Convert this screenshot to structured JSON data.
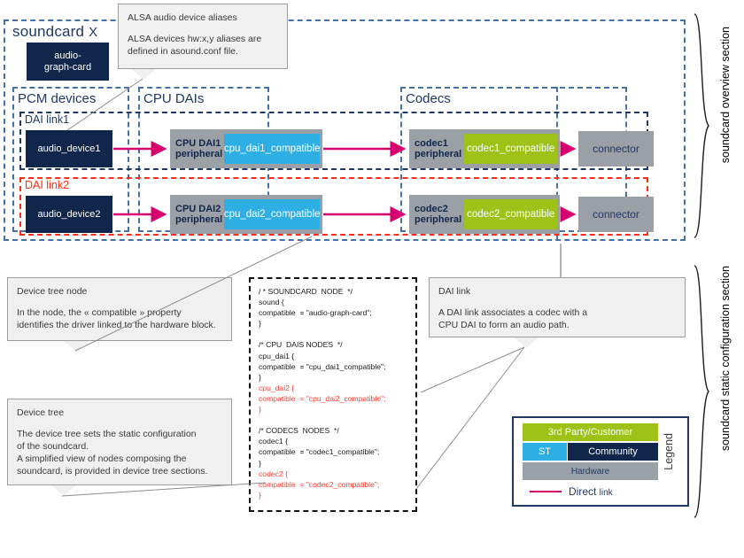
{
  "overview": {
    "soundcard_title": "soundcard",
    "soundcard_suffix": "X",
    "card_driver": "audio-\ngraph-card",
    "groups": {
      "pcm_devices": "PCM devices",
      "cpu_dais": "CPU DAIs",
      "codecs": "Codecs"
    },
    "links": [
      {
        "label": "DAI link1",
        "color": "#1f3864",
        "audio_device": "audio_device1",
        "cpu_dai_label": "CPU DAI1\nperipheral",
        "cpu_dai_compatible": "cpu_dai1_compatible",
        "codec_label": "codec1\nperipheral",
        "codec_compatible": "codec1_compatible",
        "connector": "connector"
      },
      {
        "label": "DAI link2",
        "color": "#ff2d16",
        "audio_device": "audio_device2",
        "cpu_dai_label": "CPU DAI2\nperipheral",
        "cpu_dai_compatible": "cpu_dai2_compatible",
        "codec_label": "codec2\nperipheral",
        "codec_compatible": "codec2_compatible",
        "connector": "connector"
      }
    ]
  },
  "callouts": {
    "alsa": {
      "title": "ALSA audio  device  aliases",
      "text": "ALSA devices  hw:x,y aliases are\ndefined  in asound.conf file."
    },
    "device_tree_node": {
      "title": "Device tree node",
      "text": "In the node, the  « compatible » property\nidentifies the driver  linked to the hardware  block."
    },
    "device_tree": {
      "title": "Device tree",
      "text": "The device  tree  sets the static configuration\nof the soundcard.\nA simplified  view  of nodes composing the\nsoundcard, is provided  in device  tree sections."
    },
    "dai_link": {
      "title": "DAI link",
      "text": "A DAI link  associates a codec with a\nCPU  DAI to form an audio  path."
    }
  },
  "code_block": {
    "lines": [
      {
        "text": "/ * SOUNDCARD  NODE  */",
        "red": false
      },
      {
        "text": "sound {",
        "red": false
      },
      {
        "text": "compatible  = \"audio-graph-card\";",
        "red": false
      },
      {
        "text": "}",
        "red": false
      },
      {
        "text": "",
        "red": false
      },
      {
        "text": "/* CPU  DAIS NODES  */",
        "red": false
      },
      {
        "text": "cpu_dai1 {",
        "red": false
      },
      {
        "text": "compatible  = \"cpu_dai1_compatible\";",
        "red": false
      },
      {
        "text": "}",
        "red": false
      },
      {
        "text": "cpu_dai2 {",
        "red": true
      },
      {
        "text": "compatible  = \"cpu_dai2_compatible\";",
        "red": true
      },
      {
        "text": "}",
        "red": true
      },
      {
        "text": "",
        "red": false
      },
      {
        "text": "/* CODECS  NODES  */",
        "red": false
      },
      {
        "text": "codec1 {",
        "red": false
      },
      {
        "text": "compatible  = \"codec1_compatible\";",
        "red": false
      },
      {
        "text": "}",
        "red": false
      },
      {
        "text": "codec2 {",
        "red": true
      },
      {
        "text": "compatible  = \"codec2_compatible\";",
        "red": true
      },
      {
        "text": "}",
        "red": true
      }
    ]
  },
  "legend": {
    "vertical_label": "Legend",
    "third_party": "3rd Party/Customer",
    "st": "ST",
    "community": "Community",
    "hardware": "Hardware",
    "direct_link": "Direct ",
    "direct_link_small": "link",
    "link_color": "#d6006e"
  },
  "sections": {
    "overview": "soundcard overview section",
    "static_config": "soundcard static configuration section"
  },
  "colors": {
    "navy": "#10264b",
    "blue": "#2eafe3",
    "green": "#9fc219",
    "gray": "#9ba0a6",
    "magenta": "#d6006e",
    "dash_blue": "#4472a8",
    "dash_red": "#ff2d16"
  }
}
